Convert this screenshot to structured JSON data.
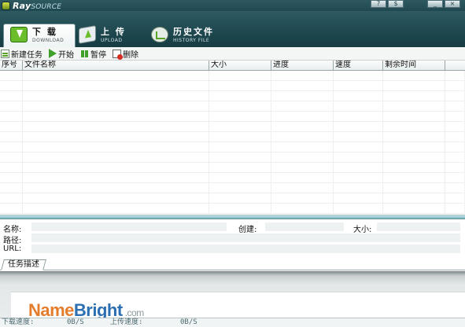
{
  "app": {
    "logo_main": "Ray",
    "logo_sub": "SOURCE",
    "window_buttons": {
      "help": "?",
      "skin": "$",
      "minimize": "_",
      "close": "×"
    }
  },
  "tabs": [
    {
      "label": "下 载",
      "sublabel": "DOWNLOAD",
      "active": true
    },
    {
      "label": "上 传",
      "sublabel": "UPLOAD",
      "active": false
    },
    {
      "label": "历史文件",
      "sublabel": "HISTORY FILE",
      "active": false
    }
  ],
  "toolbar": {
    "new_task": "新建任务",
    "start": "开始",
    "pause": "暂停",
    "delete": "删除"
  },
  "table": {
    "columns": [
      "序号",
      "文件名称",
      "大小",
      "进度",
      "速度",
      "剩余时间"
    ],
    "rows": []
  },
  "details": {
    "name_label": "名称:",
    "created_label": "创建:",
    "size_label": "大小:",
    "path_label": "路径:",
    "url_label": "URL:",
    "name_value": "",
    "created_value": "",
    "size_value": "",
    "path_value": "",
    "url_value": ""
  },
  "desc_tab": {
    "label": "任务描述"
  },
  "ad": {
    "part1": "Name",
    "part2": "Bright",
    "part3": ".com"
  },
  "status": {
    "download_label": "下载速度:",
    "download_value": "0B/S",
    "upload_label": "上传速度:",
    "upload_value": "0B/S"
  }
}
